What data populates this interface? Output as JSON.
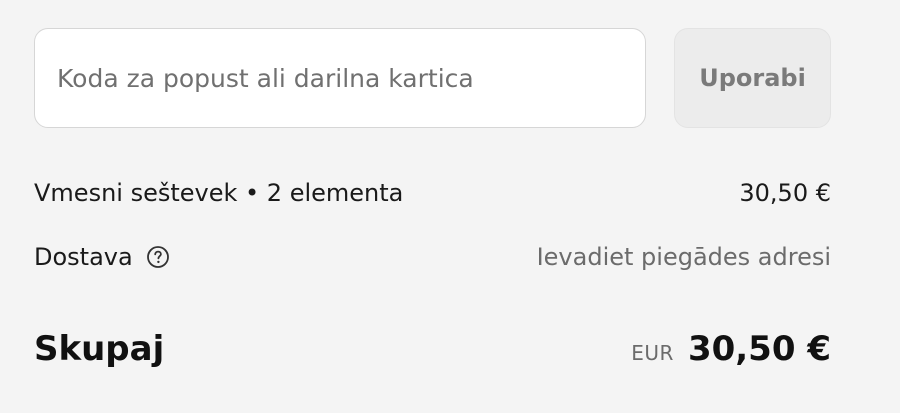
{
  "discount": {
    "placeholder": "Koda za popust ali darilna kartica",
    "value": "",
    "apply_label": "Uporabi"
  },
  "subtotal": {
    "label": "Vmesni seštevek • 2 elementa",
    "amount": "30,50 €"
  },
  "shipping": {
    "label": "Dostava",
    "help_icon": "question-circle-icon",
    "value": "Ievadiet piegādes adresi"
  },
  "total": {
    "label": "Skupaj",
    "currency_code": "EUR",
    "amount": "30,50 €"
  }
}
